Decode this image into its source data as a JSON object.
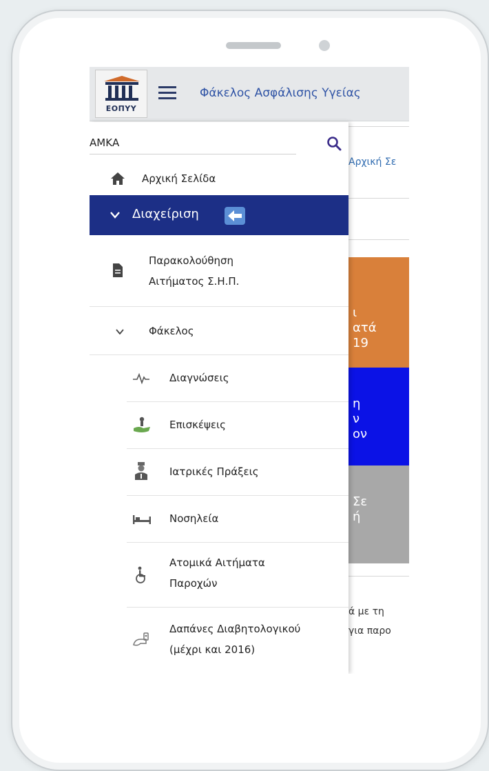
{
  "app": {
    "title": "Φάκελος Ασφάλισης Υγείας",
    "logo_text": "ΕΟΠΥΥ"
  },
  "search": {
    "placeholder": "ΑΜΚΑ"
  },
  "menu": {
    "home": "Αρχική Σελίδα",
    "admin": "Διαχείριση",
    "tracking_line1": "Παρακολούθηση",
    "tracking_line2": "Αιτήματος Σ.Η.Π.",
    "folder": "Φάκελος",
    "diagnoses": "Διαγνώσεις",
    "visits": "Επισκέψεις",
    "medical_acts": "Ιατρικές Πράξεις",
    "hospitalization": "Νοσηλεία",
    "individual_line1": "Ατομικά Αιτήματα",
    "individual_line2": "Παροχών",
    "diabetes_line1": "Δαπάνες Διαβητολογικού",
    "diabetes_line2": "(μέχρι και 2016)"
  },
  "background_page": {
    "breadcrumb": "Αρχική Σε",
    "tile_orange_line1": "ι",
    "tile_orange_line2": "ατά",
    "tile_orange_line3": "19",
    "tile_blue_line1": "η",
    "tile_blue_line2": "ν",
    "tile_blue_line3": "ον",
    "tile_gray_line1": "Σε",
    "tile_gray_line2": "ή",
    "text_line1": "ά με τη",
    "text_line2": "για παρο"
  },
  "colors": {
    "drawer_active": "#1c2f86",
    "tile_orange": "#d9803a",
    "tile_blue": "#0b12e6",
    "tile_gray": "#a8a8a8",
    "title_blue": "#2f53a5"
  }
}
